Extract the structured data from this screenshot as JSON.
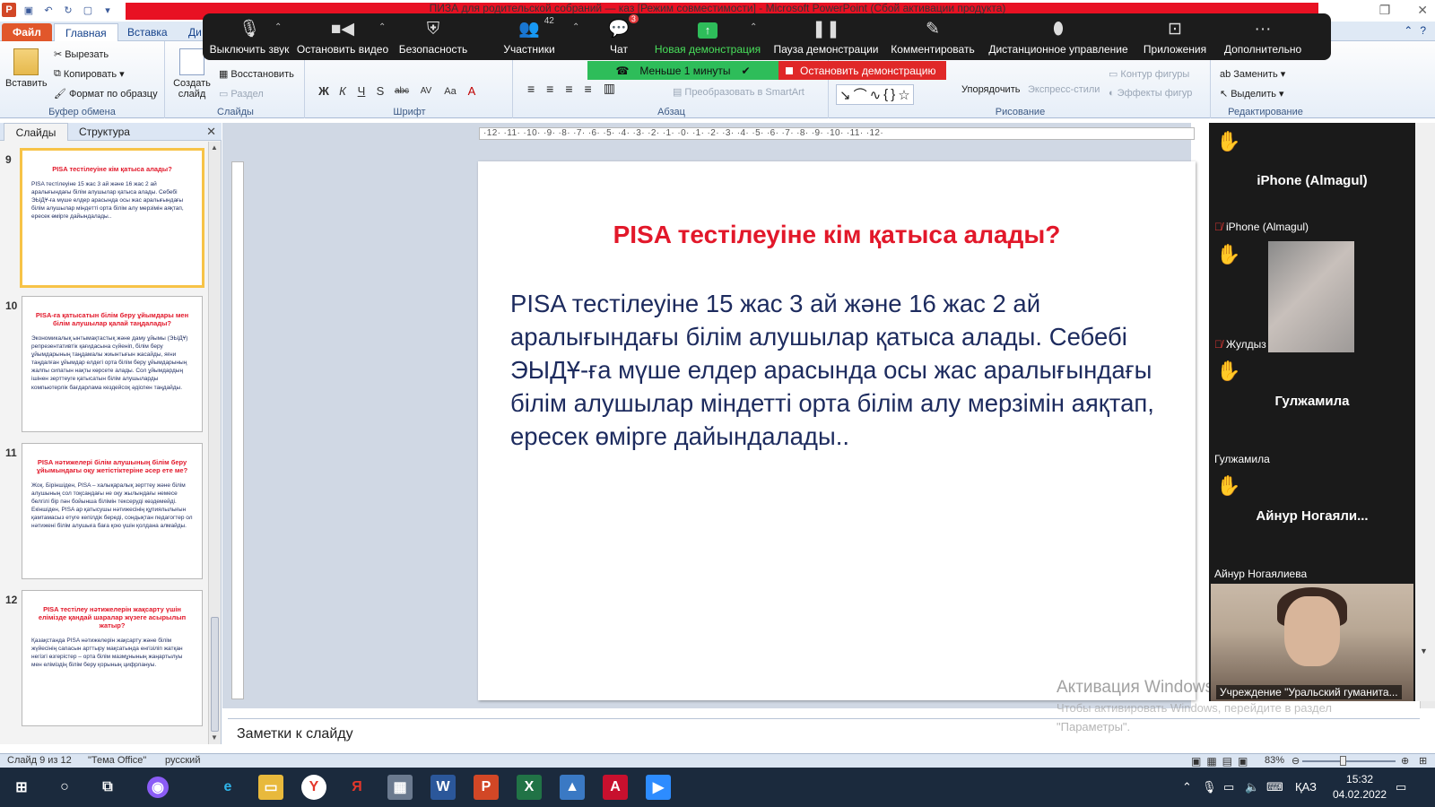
{
  "window": {
    "title": "ПИЗА для родительской собраний — каз [Режим совместимости] - Microsoft PowerPoint (Сбой активации продукта)"
  },
  "ribbon_tabs": [
    "Файл",
    "Главная",
    "Вставка",
    "Ди"
  ],
  "ribbon": {
    "clipboard": {
      "paste": "Вставить",
      "cut": "Вырезать",
      "copy": "Копировать",
      "format_painter": "Формат по образцу",
      "label": "Буфер обмена"
    },
    "slides": {
      "new_slide": "Создать слайд",
      "reset": "Восстановить",
      "section": "Раздел",
      "label": "Слайды"
    },
    "font": {
      "label": "Шрифт",
      "buttons": [
        "Ж",
        "К",
        "Ч",
        "S",
        "abc",
        "AV",
        "Aa",
        "A"
      ]
    },
    "paragraph": {
      "label": "Абзац",
      "smartart": "Преобразовать в SmartArt"
    },
    "drawing": {
      "arrange": "Упорядочить",
      "quick_styles": "Экспресс-стили",
      "shape_outline": "Контур фигуры",
      "shape_effects": "Эффекты фигур",
      "label": "Рисование"
    },
    "editing": {
      "replace": "Заменить",
      "select": "Выделить",
      "label": "Редактирование"
    }
  },
  "zoom_toolbar": {
    "buttons": [
      {
        "label": "Выключить звук",
        "icon": "microphone-icon"
      },
      {
        "label": "Остановить видео",
        "icon": "video-camera-icon"
      },
      {
        "label": "Безопасность",
        "icon": "shield-icon"
      },
      {
        "label": "Участники",
        "icon": "participants-icon",
        "count": "42"
      },
      {
        "label": "Чат",
        "icon": "chat-icon",
        "badge": "3"
      },
      {
        "label": "Новая демонстрация",
        "icon": "share-screen-icon"
      },
      {
        "label": "Пауза демонстрации",
        "icon": "pause-icon"
      },
      {
        "label": "Комментировать",
        "icon": "pencil-icon"
      },
      {
        "label": "Дистанционное управление",
        "icon": "mouse-icon"
      },
      {
        "label": "Приложения",
        "icon": "apps-icon"
      },
      {
        "label": "Дополнительно",
        "icon": "more-icon"
      }
    ],
    "timer": "Меньше 1 минуты",
    "stop_share": "Остановить демонстрацию"
  },
  "slides_pane": {
    "tabs": [
      "Слайды",
      "Структура"
    ],
    "slides": [
      {
        "number": "9",
        "title": "PISA тестілеуіне  кім қатыса  алады?",
        "body": "PISA тестілеуіне 15 жас 3 ай және 16 жас 2 ай аралығындағы білім алушылар қатыса алады. Себебі ЭЫДҰ-ға мүше елдер арасында осы жас аралығындағы білім алушылар міндетті орта білім алу мерзімін аяқтап, ересек өмірге дайындалады.."
      },
      {
        "number": "10",
        "title": "PISA-ға қатысатын  білім беру ұйымдары мен білім алушылар  қалай таңдалады?",
        "body": "Экономикалық ынтымақтастық және даму ұйымы (ЭЫДҰ) репрезентативтік қағидасына сүйеніп, білім беру ұйымдарының таңдамалы жиынтығын жасайды, яғни таңдалған ұйымдар елдегі орта білім беру ұйымдарының жалпы сипатын нақты көрсете алады. Сол ұйымдардың ішінен зерттеуге қатысатын білім алушыларды компьютерлік бағдарлама кездейсоқ әдіспен таңдайды."
      },
      {
        "number": "11",
        "title": "PISA нәтижелері  білім алушының білім беру ұйымындағы оқу жетістіктеріне   әсер ете  ме?",
        "body": "Жоқ. Біріншіден, PISA – халықаралық зерттеу және білім алушының сол тоқсандағы не оқу жылындағы немесе белгілі бір пән бойынша білімін тексеруді көздемейді. Екіншіден, PISA ар қатысушы нәтижесінің құпиялылығын қамтамасыз етуге кепілдік береді, сондықтан педагогтер ол нәтижені  білім алушыға баға қою үшін қолдана алмайды."
      },
      {
        "number": "12",
        "title": "PISA тестілеу  нәтижелерін жақсарту  үшін елімізде қандай шаралар жүзеге асырылып жатыр?",
        "body": "Қазақстанда PISA нәтижелерін жақсарту және білім жүйесінің сапасын арттыру мақсатында енгізіліп жатқан негізгі өзгерістер – орта білім мазмұнының жаңартылуы мен еліміздің білім беру қорының цифрлануы."
      }
    ]
  },
  "ruler": {
    "ticks": "·12· ·11· ·10· ·9· ·8· ·7· ·6· ·5· ·4· ·3· ·2· ·1· ·0· ·1· ·2· ·3· ·4· ·5· ·6· ·7· ·8· ·9· ·10· ·11· ·12·"
  },
  "slide": {
    "title": "PISA тестілеуіне  кім қатыса  алады?",
    "body": "PISA тестілеуіне  15 жас 3 ай және 16 жас 2 ай аралығындағы  білім алушылар  қатыса  алады.  Себебі ЭЫДҰ-ға мүше елдер арасында  осы жас аралығындағы  білім алушылар  міндетті  орта  білім алу  мерзімін  аяқтап,  ересек  өмірге  дайындалады.."
  },
  "notes_placeholder": "Заметки к слайду",
  "activation": {
    "title": "Активация Windows",
    "line1": "Чтобы активировать Windows, перейдите в раздел",
    "line2": "\"Параметры\"."
  },
  "participants": [
    {
      "tile_name": "iPhone (Almagul)",
      "label": "",
      "hand": true
    },
    {
      "tile_name": "",
      "label": "iPhone (Almagul)",
      "hand": true,
      "muted": true,
      "video": "blurred"
    },
    {
      "tile_name": "",
      "label": "Жулдыз",
      "hand": true,
      "muted": true
    },
    {
      "tile_name": "Гулжамила",
      "label": "Гулжамила",
      "hand": true
    },
    {
      "tile_name": "Айнур  Ногаяли...",
      "label": "Айнур Ногаялиева",
      "hand": true
    },
    {
      "tile_name": "",
      "label": "Учреждение \"Уральский гуманита...",
      "video": "face"
    }
  ],
  "statusbar": {
    "slide_info": "Слайд 9 из 12",
    "theme": "\"Тема Office\"",
    "language": "русский",
    "zoom": "83%"
  },
  "taskbar": {
    "lang": "ҚАЗ",
    "time": "15:32",
    "date": "04.02.2022"
  },
  "colors": {
    "slide_title": "#e2182a",
    "slide_body": "#1d2b5e",
    "zoom_share_green": "#2ebd5a",
    "zoom_stop_red": "#e02828",
    "hand_yellow": "#f8c43b"
  }
}
